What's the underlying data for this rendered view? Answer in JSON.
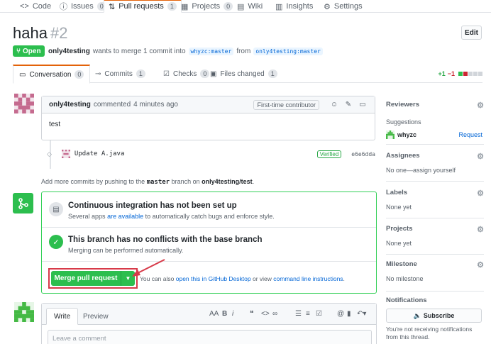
{
  "repo_nav": {
    "tabs": [
      {
        "icon": "code-icon",
        "label": "Code",
        "count": ""
      },
      {
        "icon": "issue-icon",
        "label": "Issues",
        "count": "0"
      },
      {
        "icon": "pr-icon",
        "label": "Pull requests",
        "count": "1"
      },
      {
        "icon": "project-icon",
        "label": "Projects",
        "count": "0"
      },
      {
        "icon": "book-icon",
        "label": "Wiki",
        "count": ""
      },
      {
        "icon": "graph-icon",
        "label": "Insights",
        "count": ""
      },
      {
        "icon": "gear-icon",
        "label": "Settings",
        "count": ""
      }
    ]
  },
  "pr": {
    "title": "haha",
    "number": "#2",
    "edit_label": "Edit",
    "state": "Open",
    "author": "only4testing",
    "meta_text": "wants to merge 1 commit into",
    "base_branch": "whyzc:master",
    "from_text": "from",
    "head_branch": "only4testing:master"
  },
  "pr_tabs": [
    {
      "label": "Conversation",
      "count": "0"
    },
    {
      "label": "Commits",
      "count": "1"
    },
    {
      "label": "Checks",
      "count": "0"
    },
    {
      "label": "Files changed",
      "count": "1"
    }
  ],
  "diffstat": {
    "add": "+1",
    "del": "−1",
    "colors": [
      "#2cbe4e",
      "#cb2431",
      "#d1d5da",
      "#d1d5da",
      "#d1d5da"
    ]
  },
  "comment": {
    "author": "only4testing",
    "action": "commented",
    "time": "4 minutes ago",
    "badge": "First-time contributor",
    "body": "test"
  },
  "commit": {
    "message": "Update A.java",
    "verified": "Verified",
    "sha": "e6e6dda"
  },
  "push_hint": {
    "prefix": "Add more commits by pushing to the",
    "branch": "master",
    "middle": "branch on",
    "repo": "only4testing/test",
    "suffix": "."
  },
  "merge": {
    "ci_title": "Continuous integration has not been set up",
    "ci_sub_prefix": "Several apps",
    "ci_sub_link": "are available",
    "ci_sub_suffix": "to automatically catch bugs and enforce style.",
    "ok_title": "This branch has no conflicts with the base branch",
    "ok_sub": "Merging can be performed automatically.",
    "button_label": "Merge pull request",
    "alt_prefix": "You can also",
    "alt_link1": "open this in GitHub Desktop",
    "alt_middle": "or view",
    "alt_link2": "command line instructions",
    "alt_suffix": "."
  },
  "new_comment": {
    "write_tab": "Write",
    "preview_tab": "Preview",
    "placeholder": "Leave a comment"
  },
  "sidebar": {
    "reviewers": {
      "title": "Reviewers",
      "sub": "Suggestions",
      "user": "whyzc",
      "request": "Request"
    },
    "assignees": {
      "title": "Assignees",
      "value": "No one—assign yourself"
    },
    "labels": {
      "title": "Labels",
      "value": "None yet"
    },
    "projects": {
      "title": "Projects",
      "value": "None yet"
    },
    "milestone": {
      "title": "Milestone",
      "value": "No milestone"
    },
    "notifications": {
      "title": "Notifications",
      "button": "Subscribe",
      "text": "You're not receiving notifications from this thread."
    }
  },
  "colors": {
    "accent_green": "#2cbe4e",
    "link_blue": "#0366d6",
    "annotation_red": "#d73a49",
    "tab_orange": "#e36209"
  }
}
